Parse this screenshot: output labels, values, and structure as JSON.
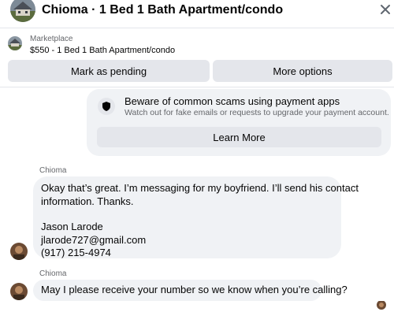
{
  "header": {
    "title": "Chioma · 1 Bed 1 Bath Apartment/condo",
    "close_icon": "close-icon"
  },
  "listing": {
    "source": "Marketplace",
    "title": "$550 - 1 Bed 1 Bath Apartment/condo",
    "thumb_icon": "house-photo",
    "actions": {
      "pending_label": "Mark as pending",
      "more_label": "More options"
    }
  },
  "scam_notice": {
    "icon": "shield-icon",
    "title": "Beware of common scams using payment apps",
    "subtitle": "Watch out for fake emails or requests to upgrade your payment account.",
    "button_label": "Learn More"
  },
  "messages": [
    {
      "sender": "Chioma",
      "lines": [
        "Okay that’s great. I’m messaging for my boyfriend. I’ll send his contact",
        "information. Thanks.",
        "",
        "Jason Larode",
        "jlarode727@gmail.com",
        "(917) 215-4974"
      ]
    },
    {
      "sender": "Chioma",
      "text": "May I please receive your number so we know when you’re calling?"
    }
  ],
  "colors": {
    "bubble_bg": "#f0f2f5",
    "button_bg": "#e4e6eb",
    "secondary_text": "#65676b",
    "primary_text": "#050505"
  }
}
